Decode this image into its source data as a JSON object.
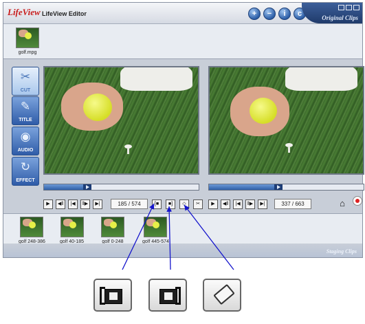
{
  "app": {
    "logo": "LifeView",
    "title": "LifeView Editor"
  },
  "header": {
    "buttons": [
      {
        "name": "add-icon",
        "glyph": "+"
      },
      {
        "name": "remove-icon",
        "glyph": "−"
      },
      {
        "name": "info-icon",
        "glyph": "i"
      },
      {
        "name": "copyright-icon",
        "glyph": "c"
      }
    ],
    "original_clips_label": "Original Clips"
  },
  "original_clips": [
    {
      "label": "golf.mpg"
    }
  ],
  "sidebar": [
    {
      "label": "CUT",
      "icon": "scissors-icon",
      "glyph": "✂",
      "active": true
    },
    {
      "label": "TITLE",
      "icon": "pen-icon",
      "glyph": "✎",
      "active": false
    },
    {
      "label": "AUDIO",
      "icon": "sound-waves-icon",
      "glyph": "◉",
      "active": false
    },
    {
      "label": "EFFECT",
      "icon": "effect-swirl-icon",
      "glyph": "↻",
      "active": false
    }
  ],
  "left_player": {
    "counter": "185 / 574",
    "progress": 0.28
  },
  "right_player": {
    "counter": "337 / 663",
    "progress": 0.45
  },
  "staging_clips": [
    {
      "label": "golf 248-386"
    },
    {
      "label": "golf 40-185"
    },
    {
      "label": "golf 0-248"
    },
    {
      "label": "golf 445-574"
    }
  ],
  "staging_clips_label": "Staging Clips",
  "colors": {
    "accent": "#2f5ca8",
    "record": "#dd2222"
  }
}
